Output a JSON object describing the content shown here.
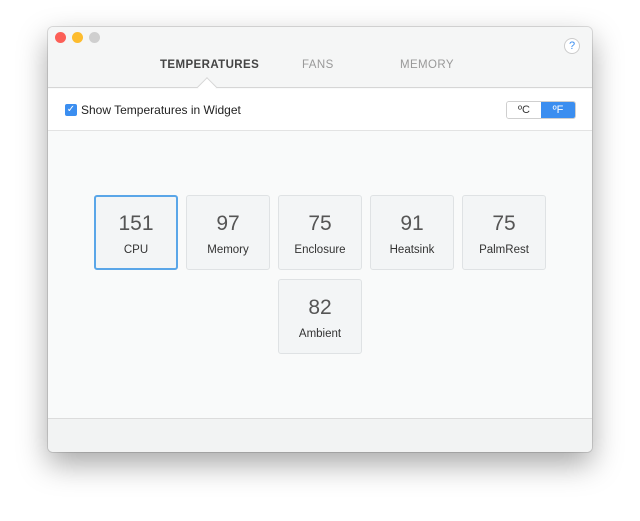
{
  "tabs": [
    {
      "label": "TEMPERATURES",
      "active": true
    },
    {
      "label": "FANS"
    },
    {
      "label": "MEMORY"
    }
  ],
  "help_label": "?",
  "options": {
    "show_widget_label": "Show Temperatures in Widget",
    "show_widget_checked": true,
    "unit_c": "ºC",
    "unit_f": "ºF",
    "selected_unit": "F"
  },
  "sensors": [
    {
      "value": "151",
      "label": "CPU"
    },
    {
      "value": "97",
      "label": "Memory"
    },
    {
      "value": "75",
      "label": "Enclosure"
    },
    {
      "value": "91",
      "label": "Heatsink"
    },
    {
      "value": "75",
      "label": "PalmRest"
    },
    {
      "value": "82",
      "label": "Ambient"
    }
  ],
  "colors": {
    "accent": "#3b8ef0"
  }
}
